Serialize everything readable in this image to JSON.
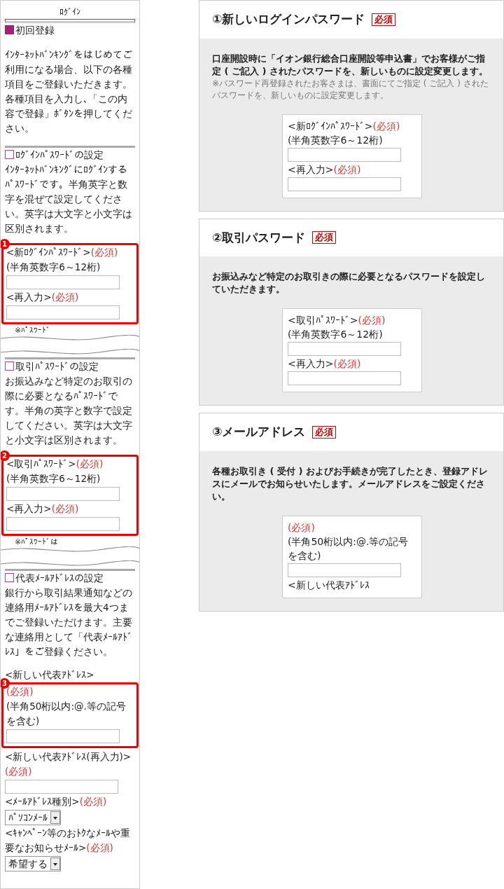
{
  "phone": {
    "title": "ﾛｸﾞｲﾝ",
    "heading": "初回登録",
    "intro": [
      "ｲﾝﾀｰﾈｯﾄﾊﾞﾝｷﾝｸﾞをはじめてご利用になる場合、以下の各種項目をご登録いただきます。",
      "各種項目を入力し､「この内容で登録」ﾎﾞﾀﾝを押してください。"
    ],
    "sections": [
      {
        "title": "ﾛｸﾞｲﾝﾊﾟｽﾜｰﾄﾞの設定",
        "text": "ｲﾝﾀｰﾈｯﾄﾊﾞﾝｷﾝｸﾞにﾛｸﾞｲﾝするﾊﾟｽﾜｰﾄﾞです。半角英字と数字を混ぜて設定してください。英字は大文字と小文字は区別されます。",
        "callout": {
          "number": "1",
          "items": [
            {
              "kind": "label",
              "text": "<新ﾛｸﾞｲﾝﾊﾟｽﾜｰﾄﾞ>",
              "required": "(必須)"
            },
            {
              "kind": "hint",
              "text": "(半角英数字6～12桁)"
            },
            {
              "kind": "input"
            },
            {
              "kind": "label",
              "text": "<再入力>",
              "required": "(必須)"
            },
            {
              "kind": "input"
            }
          ]
        },
        "cut_note": "※ﾊﾟｽﾜｰﾄﾞ"
      },
      {
        "title": "取引ﾊﾟｽﾜｰﾄﾞの設定",
        "text": "お振込みなど特定のお取引の際に必要となるﾊﾟｽﾜｰﾄﾞです。半角の英字と数字で設定してください。英字は大文字と小文字は区別されます。",
        "callout": {
          "number": "2",
          "items": [
            {
              "kind": "label",
              "text": "<取引ﾊﾟｽﾜｰﾄﾞ>",
              "required": "(必須)"
            },
            {
              "kind": "hint",
              "text": "(半角英数字6～12桁)"
            },
            {
              "kind": "input"
            },
            {
              "kind": "label",
              "text": "<再入力>",
              "required": "(必須)"
            },
            {
              "kind": "input"
            }
          ]
        },
        "cut_note": "※ﾊﾟｽﾜｰﾄﾞは"
      },
      {
        "title": "代表ﾒｰﾙｱﾄﾞﾚｽの設定",
        "text": "銀行から取引結果通知などの連絡用ﾒｰﾙｱﾄﾞﾚｽを最大4つまでご登録いただけます。主要な連絡用として「代表ﾒｰﾙｱﾄﾞﾚｽ」をご登録ください。",
        "before": [
          {
            "kind": "label",
            "text": "<新しい代表ｱﾄﾞﾚｽ>"
          }
        ],
        "callout": {
          "number": "3",
          "items": [
            {
              "kind": "required",
              "text": "(必須)"
            },
            {
              "kind": "hint",
              "text": "(半角50桁以内:@.等の記号を含む)"
            },
            {
              "kind": "input"
            }
          ]
        },
        "after": [
          {
            "kind": "label",
            "text": "<新しい代表ｱﾄﾞﾚｽ(再入力)>",
            "required": "(必須)"
          },
          {
            "kind": "input"
          },
          {
            "kind": "label",
            "text": "<ﾒｰﾙｱﾄﾞﾚｽ種別>",
            "required": "(必須)"
          },
          {
            "kind": "select",
            "value": "ﾊﾟｿｺﾝﾒｰﾙ"
          },
          {
            "kind": "label",
            "text": "<ｷｬﾝﾍﾟｰﾝ等のおﾄｸなﾒｰﾙや重要なお知らせﾒｰﾙ>",
            "required": "(必須)"
          },
          {
            "kind": "select",
            "value": "希望する"
          }
        ]
      }
    ]
  },
  "cards": [
    {
      "title": "①新しいログインパスワード",
      "badge": "必須",
      "description": "口座開設時に「イオン銀行総合口座開設等申込書」でお客様がご指定 ( ご記入 ) されたパスワードを、新しいものに設定変更します。",
      "note": "※パスワード再登録されたお客さまは、書面にてご指定 ( ご記入 ) されたパスワードを、新しいものに設定変更します。",
      "preview": [
        {
          "kind": "label",
          "text": "<新ﾛｸﾞｲﾝﾊﾟｽﾜｰﾄﾞ>",
          "required": "(必須)"
        },
        {
          "kind": "hint",
          "text": "(半角英数字6～12桁)"
        },
        {
          "kind": "input"
        },
        {
          "kind": "label",
          "text": "<再入力>",
          "required": "(必須)"
        },
        {
          "kind": "input"
        }
      ]
    },
    {
      "title": "②取引パスワード",
      "badge": "必須",
      "description": "お振込みなど特定のお取引きの際に必要となるパスワードを設定していただきます。",
      "preview": [
        {
          "kind": "label",
          "text": "<取引ﾊﾟｽﾜｰﾄﾞ>",
          "required": "(必須)"
        },
        {
          "kind": "hint",
          "text": "(半角英数字6～12桁)"
        },
        {
          "kind": "input"
        },
        {
          "kind": "label",
          "text": "<再入力>",
          "required": "(必須)"
        },
        {
          "kind": "input"
        }
      ]
    },
    {
      "title": "③メールアドレス",
      "badge": "必須",
      "description": "各種お取引き ( 受付 ) およびお手続きが完了したとき、登録アドレスにメールでお知らせいたします。メールアドレスをご設定ください。",
      "preview": [
        {
          "kind": "required",
          "text": "(必須)"
        },
        {
          "kind": "hint",
          "text": "(半角50桁以内:@.等の記号を含む)"
        },
        {
          "kind": "input"
        },
        {
          "kind": "label",
          "text": "<新しい代表ｱﾄﾞﾚｽ"
        }
      ]
    }
  ]
}
